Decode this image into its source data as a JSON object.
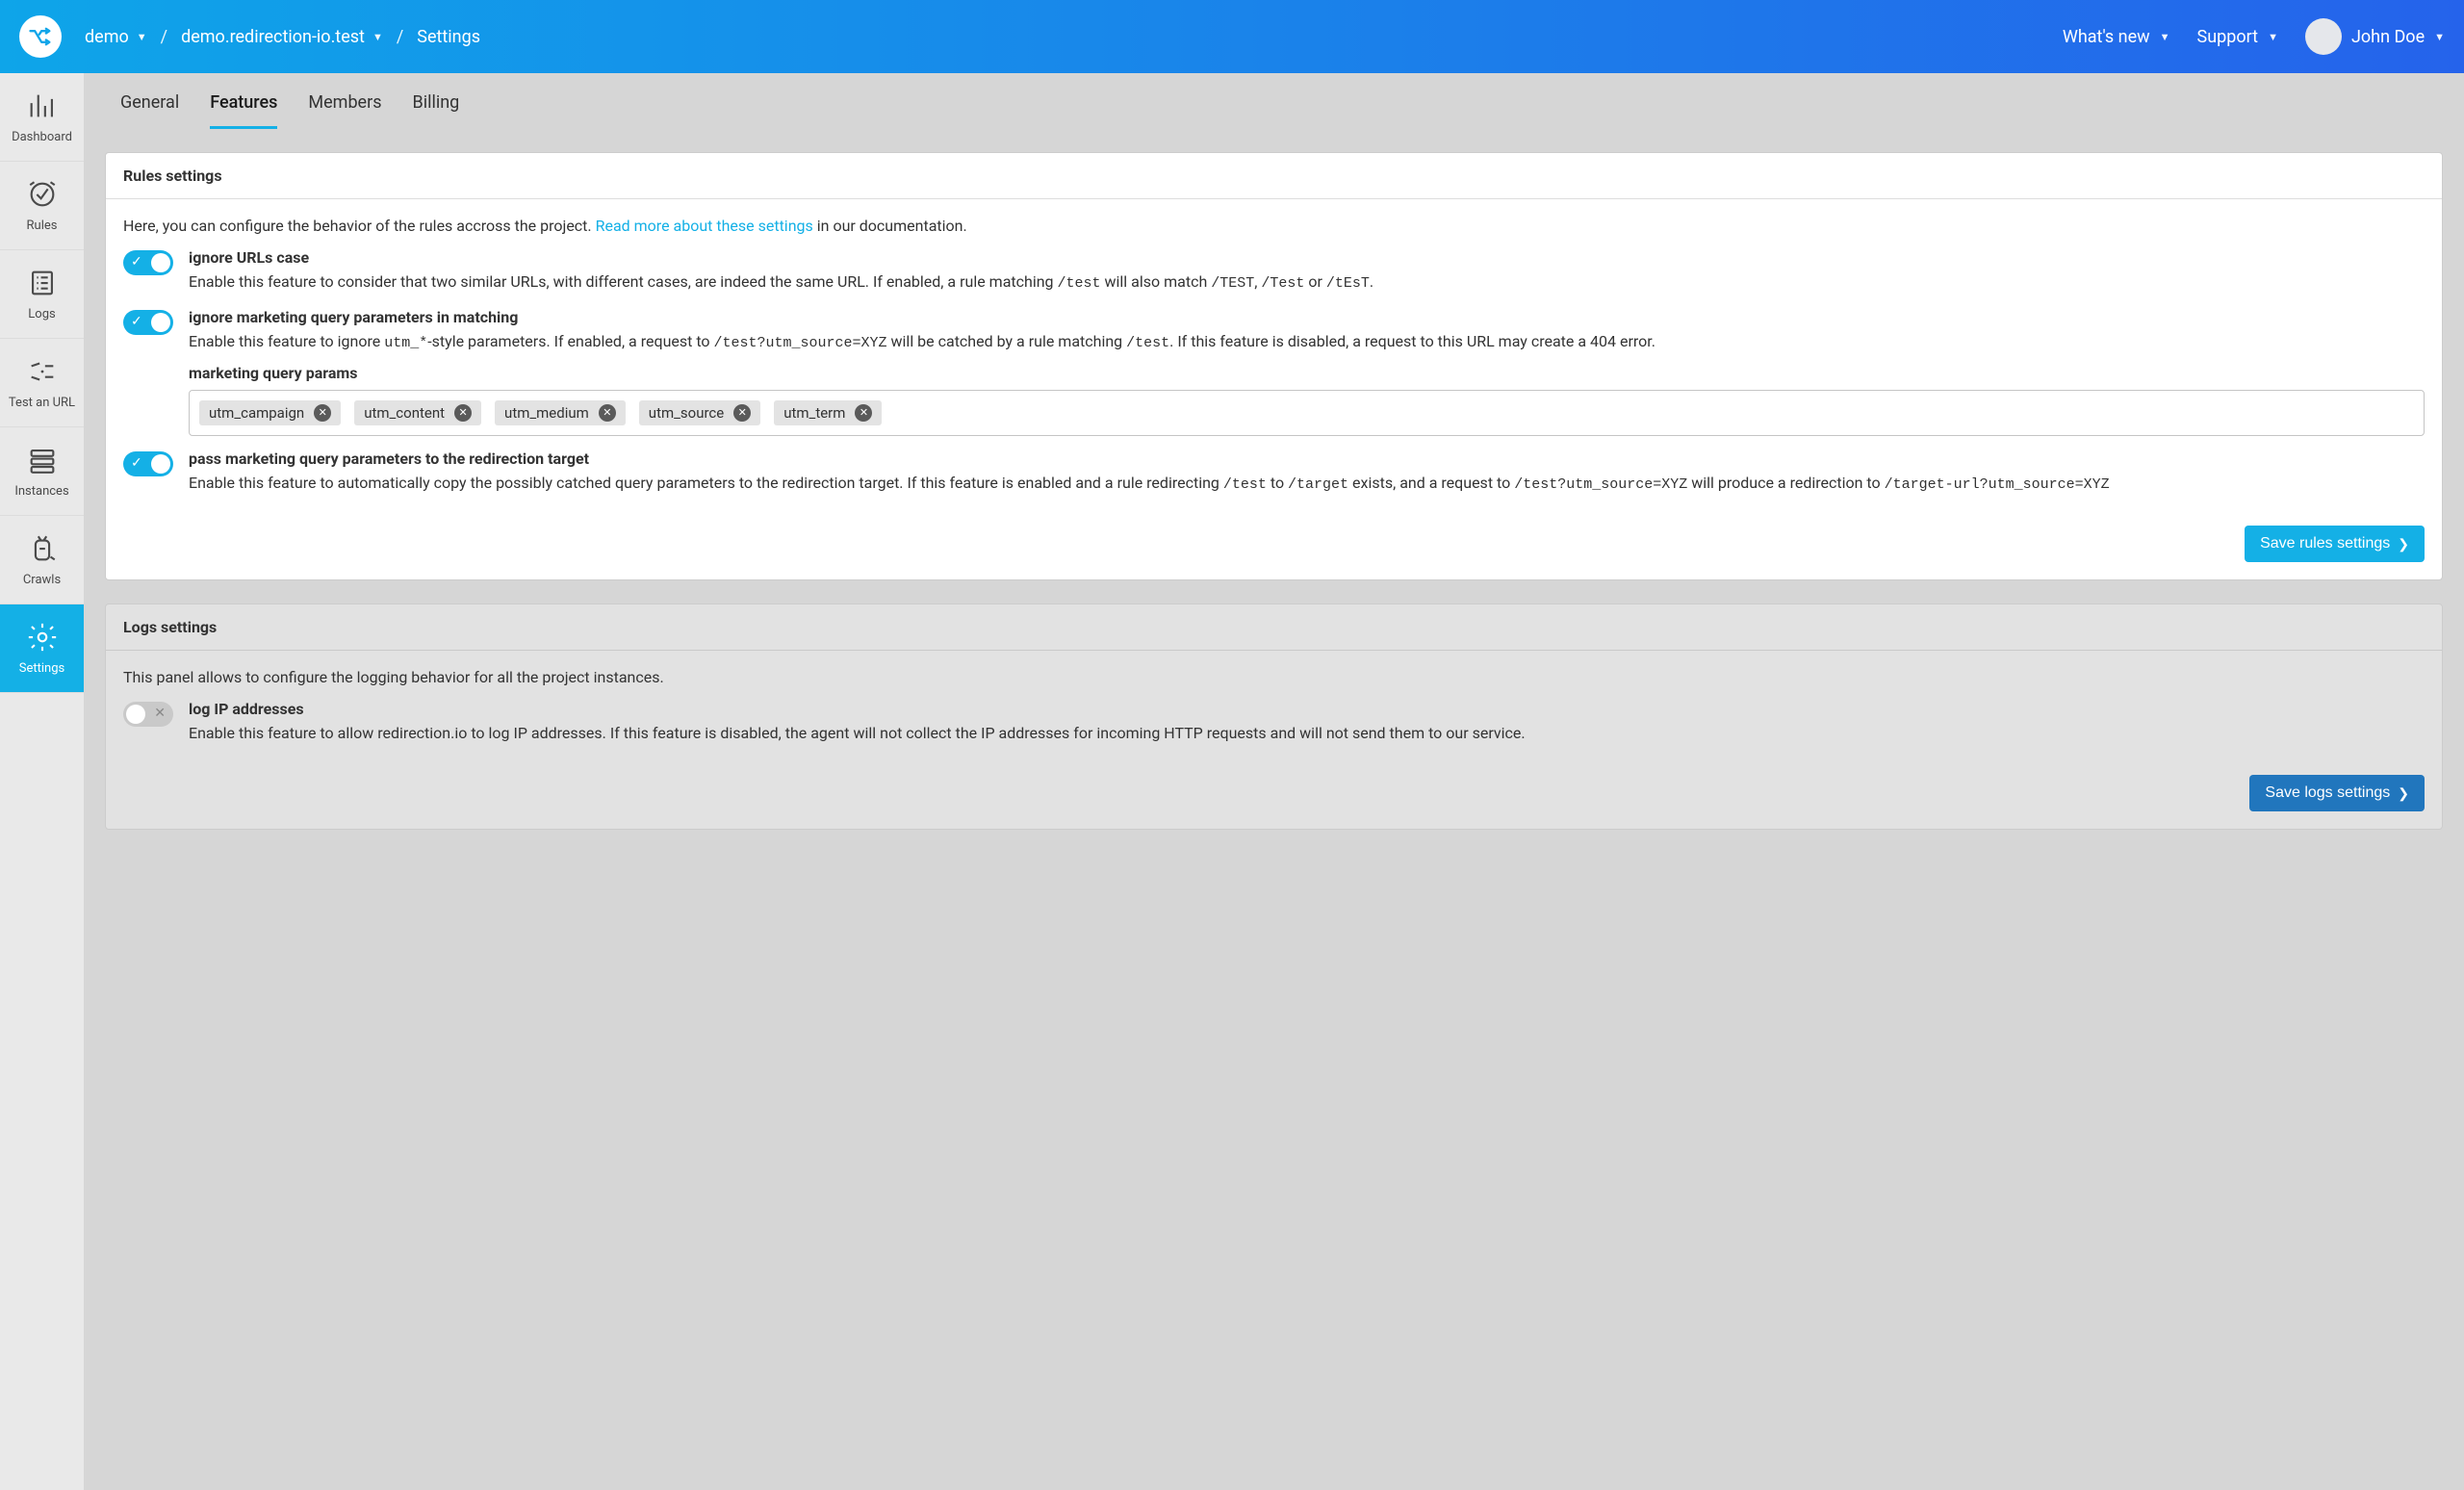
{
  "header": {
    "breadcrumb": {
      "org": "demo",
      "project": "demo.redirection-io.test",
      "page": "Settings"
    },
    "whats_new": "What's new",
    "support": "Support",
    "user_name": "John Doe"
  },
  "sidebar": {
    "dashboard": "Dashboard",
    "rules": "Rules",
    "logs": "Logs",
    "test_url": "Test an URL",
    "instances": "Instances",
    "crawls": "Crawls",
    "settings": "Settings"
  },
  "tabs": {
    "general": "General",
    "features": "Features",
    "members": "Members",
    "billing": "Billing"
  },
  "rules_panel": {
    "title": "Rules settings",
    "intro_prefix": "Here, you can configure the behavior of the rules accross the project. ",
    "intro_link": "Read more about these settings",
    "intro_suffix": " in our documentation.",
    "f1_title": "ignore URLs case",
    "f1_desc_a": "Enable this feature to consider that two similar URLs, with different cases, are indeed the same URL. If enabled, a rule matching ",
    "f1_code1": "/test",
    "f1_desc_b": " will also match ",
    "f1_code2": "/TEST",
    "f1_desc_c": ", ",
    "f1_code3": "/Test",
    "f1_desc_d": " or ",
    "f1_code4": "/tEsT",
    "f1_desc_e": ".",
    "f2_title": "ignore marketing query parameters in matching",
    "f2_desc_a": "Enable this feature to ignore ",
    "f2_code1": "utm_*",
    "f2_desc_b": "-style parameters. If enabled, a request to ",
    "f2_code2": "/test?utm_source=XYZ",
    "f2_desc_c": "  will be catched by a rule matching ",
    "f2_code3": "/test",
    "f2_desc_d": ". If this feature is disabled, a request to this URL may create a 404 error.",
    "f2_subhead": "marketing query params",
    "tags": [
      "utm_campaign",
      "utm_content",
      "utm_medium",
      "utm_source",
      "utm_term"
    ],
    "f3_title": "pass marketing query parameters to the redirection target",
    "f3_desc_a": "Enable this feature to automatically copy the possibly catched query parameters to the redirection target. If this feature is enabled and a rule redirecting ",
    "f3_code1": "/test",
    "f3_desc_b": " to ",
    "f3_code2": "/target",
    "f3_desc_c": " exists, and a request to ",
    "f3_code3": "/test?utm_source=XYZ",
    "f3_desc_d": " will produce a redirection to ",
    "f3_code4": "/target-url?utm_source=XYZ",
    "save": "Save rules settings"
  },
  "logs_panel": {
    "title": "Logs settings",
    "intro": "This panel allows to configure the logging behavior for all the project instances.",
    "f1_title": "log IP addresses",
    "f1_desc": "Enable this feature to allow redirection.io to log IP addresses. If this feature is disabled, the agent will not collect the IP addresses for incoming HTTP requests and will not send them to our service.",
    "save": "Save logs settings"
  }
}
